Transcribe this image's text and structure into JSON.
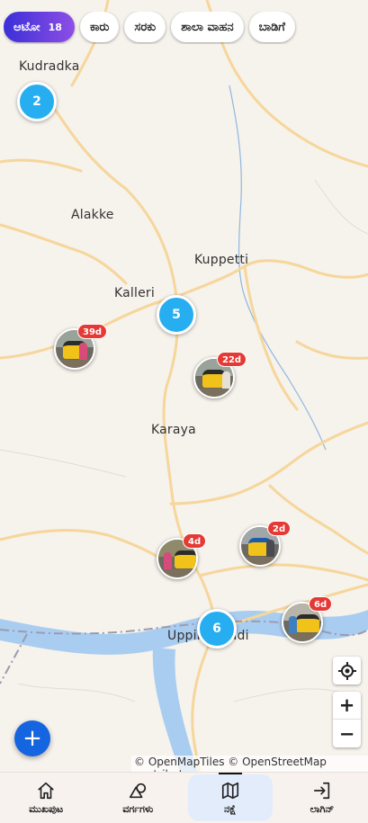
{
  "chips": [
    {
      "label": "ಆಟೋ",
      "count": "18",
      "active": true
    },
    {
      "label": "ಕಾರು"
    },
    {
      "label": "ಸರಕು"
    },
    {
      "label": "ಶಾಲಾ ವಾಹನ"
    },
    {
      "label": "ಬಾಡಿಗೆ"
    }
  ],
  "places": {
    "kudradka": "Kudradka",
    "alakke": "Alakke",
    "kuppetti": "Kuppetti",
    "kalleri": "Kalleri",
    "karaya": "Karaya",
    "uppinangadi": "Uppinangadi"
  },
  "clusters": {
    "c1": "2",
    "c2": "5",
    "c3": "6"
  },
  "pins": {
    "p1": "39d",
    "p2": "22d",
    "p3": "4d",
    "p4": "2d",
    "p5": "6d"
  },
  "controls": {
    "zoom_in": "+",
    "zoom_out": "−",
    "fab": "+"
  },
  "attribution": "© OpenMapTiles © OpenStreetMap contributors",
  "nav": [
    {
      "label": "ಮುಖಪುಟ",
      "icon": "home-icon"
    },
    {
      "label": "ವರ್ಗಗಳು",
      "icon": "shapes-icon"
    },
    {
      "label": "ನಕ್ಷೆ",
      "icon": "map-icon",
      "active": true
    },
    {
      "label": "ಲಾಗಿನ್",
      "icon": "login-icon"
    }
  ],
  "colors": {
    "cluster": "#27aef0",
    "badge": "#e53935",
    "fab": "#1565e0",
    "chip_active_start": "#3b2fd8",
    "chip_active_end": "#8e4ee6"
  }
}
